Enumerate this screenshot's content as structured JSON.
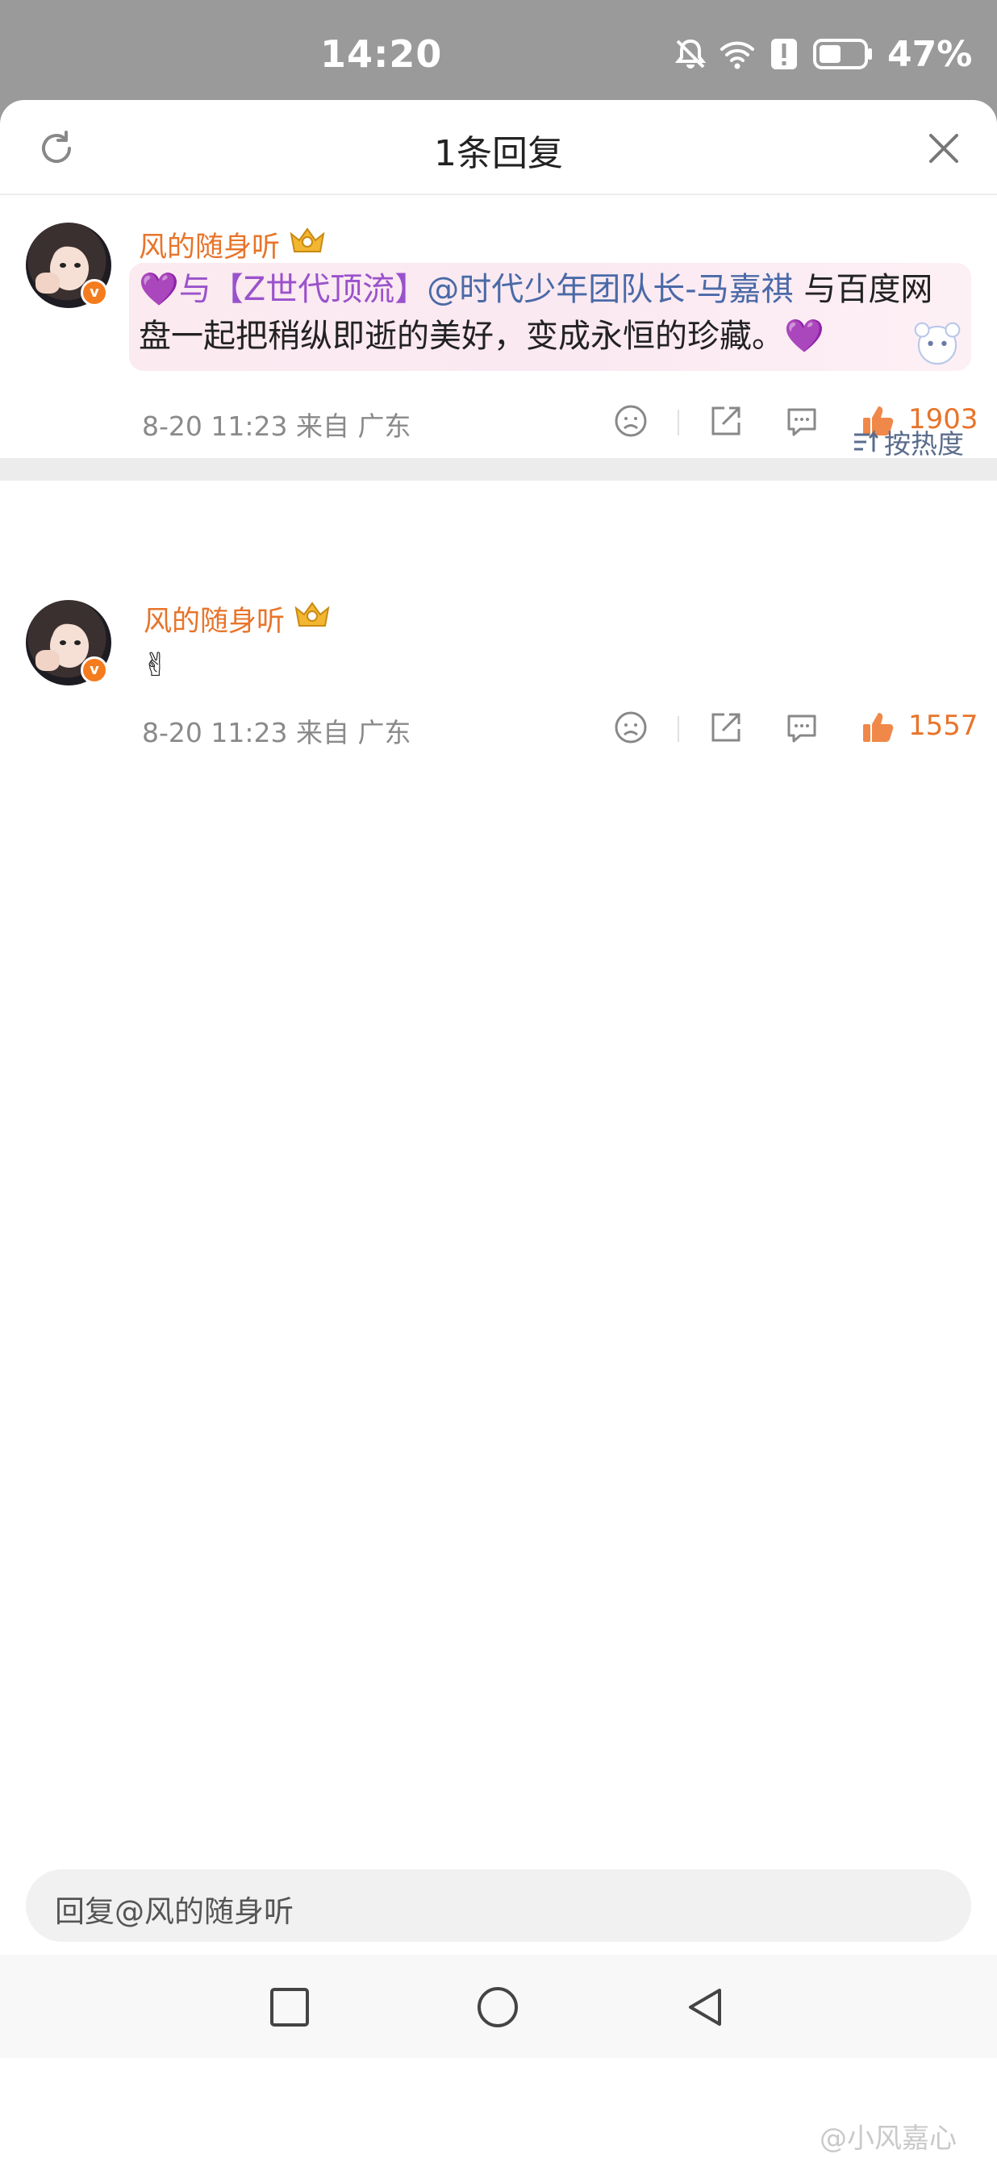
{
  "status_bar": {
    "time": "14:20",
    "battery_percent": "47%",
    "icons": [
      "bell-off-icon",
      "wifi-icon",
      "alert-icon",
      "battery-icon"
    ]
  },
  "header": {
    "title": "1条回复",
    "refresh_icon": "refresh-icon",
    "close_icon": "close-icon"
  },
  "main_comment": {
    "username": "风的随身听",
    "badge": "crown-icon",
    "text_prefix": "💜与【Z世代顶流】",
    "mention": "@时代少年团队长-马嘉祺",
    "text_suffix": " 与百度网",
    "line2": "盘一起把稍纵即逝的美好，变成永恒的珍藏。💜",
    "meta": "8-20 11:23  来自 广东",
    "likes": "1903"
  },
  "sort_label": "按热度",
  "reply": {
    "username": "风的随身听",
    "text": "✌",
    "meta": "8-20 11:23  来自 广东",
    "likes": "1557"
  },
  "reply_input": {
    "placeholder": "回复@风的随身听"
  },
  "nav": [
    "square-recents-icon",
    "circle-home-icon",
    "triangle-back-icon"
  ],
  "watermark": "@小风嘉心",
  "colors": {
    "accent": "#e8742a",
    "mention": "#4a6aa7",
    "status_bar": "#9a9a9a"
  }
}
